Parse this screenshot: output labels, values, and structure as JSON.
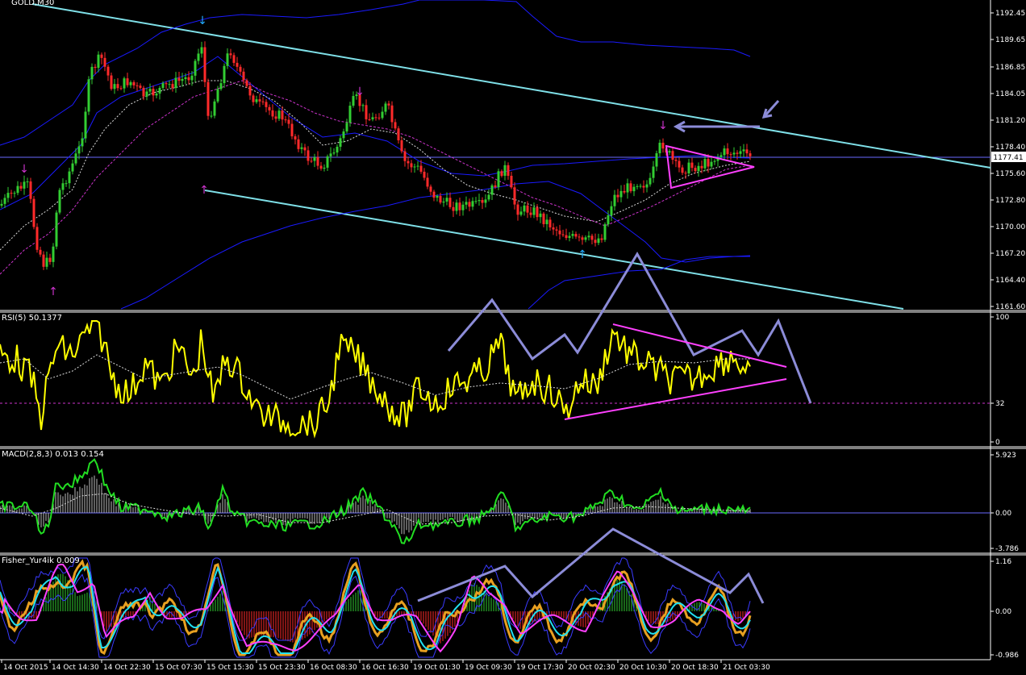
{
  "symbol_label": "GOLD,M30",
  "price_panel": {
    "ticks": [
      "1192.45",
      "1189.65",
      "1186.85",
      "1184.05",
      "1181.20",
      "1178.40",
      "1175.60",
      "1172.80",
      "1170.00",
      "1167.20",
      "1164.40",
      "1161.60"
    ],
    "current_price": "1177.41"
  },
  "rsi_panel": {
    "label": "RSI(5) 50.1377",
    "ticks": [
      "100",
      "32",
      "0"
    ]
  },
  "macd_panel": {
    "label": "MACD(2,8,3) 0.013 0.154",
    "ticks": [
      "5.923",
      "0.00",
      "-3.786"
    ]
  },
  "fisher_panel": {
    "label": "Fisher_Yur4ik 0.009",
    "ticks": [
      "1.16",
      "0.00",
      "-0.986"
    ]
  },
  "time_axis": [
    "14 Oct 2015",
    "14 Oct 14:30",
    "14 Oct 22:30",
    "15 Oct 07:30",
    "15 Oct 15:30",
    "15 Oct 23:30",
    "16 Oct 08:30",
    "16 Oct 16:30",
    "19 Oct 01:30",
    "19 Oct 09:30",
    "19 Oct 17:30",
    "20 Oct 02:30",
    "20 Oct 10:30",
    "20 Oct 18:30",
    "21 Oct 03:30"
  ],
  "colors": {
    "background": "#000000",
    "bull_candle": "#32cd32",
    "bear_candle": "#ff2a2a",
    "channel": "#7fe0e8",
    "bollinger": "#1a1aff",
    "annotation_arrow": "#8c8cd8",
    "triangle": "#ff40ff",
    "rsi": "#ffff00",
    "macd": "#22dd22",
    "fisher_orange": "#e8a020",
    "fisher_cyan": "#22e0f0",
    "fisher_magenta": "#ff40ff",
    "axis_text": "#ffffff"
  },
  "icons": {
    "down_arrow_marker": "arrow-down-icon",
    "up_arrow_marker": "arrow-up-icon"
  }
}
